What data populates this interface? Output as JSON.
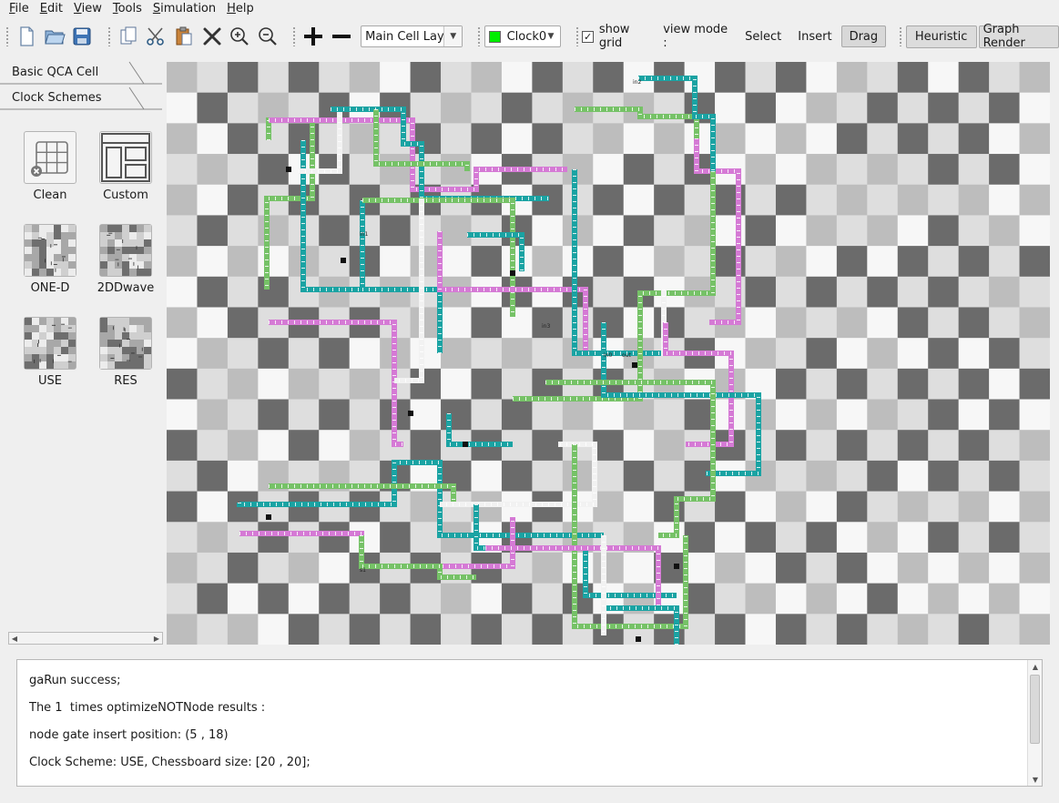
{
  "menubar": {
    "items": [
      {
        "key": "F",
        "rest": "ile"
      },
      {
        "key": "E",
        "rest": "dit"
      },
      {
        "key": "V",
        "rest": "iew"
      },
      {
        "key": "T",
        "rest": "ools"
      },
      {
        "key": "S",
        "rest": "imulation"
      },
      {
        "key": "H",
        "rest": "elp"
      }
    ]
  },
  "toolbar": {
    "layer_select": "Main Cell Layer",
    "clock_select": "Clock0",
    "clock_color": "#00ee00",
    "show_grid_label": "show grid",
    "show_grid_checked": "✓",
    "view_mode_label": "view mode :",
    "mode_select": "Select",
    "mode_insert": "Insert",
    "mode_drag": "Drag",
    "heuristic_label": "Heuristic",
    "graph_render_label": "Graph Render"
  },
  "left_panel": {
    "tab_basic": "Basic QCA Cell",
    "tab_clock": "Clock Schemes",
    "schemes": [
      "Clean",
      "Custom",
      "ONE-D",
      "2DDwave",
      "USE",
      "RES"
    ]
  },
  "canvas": {
    "grid_columns": 29,
    "grid_rows": 19,
    "colors": {
      "dark": "#6b6b6b",
      "mid": "#bdbdbd",
      "light": "#dedede",
      "white": "#f7f7f7",
      "wire_green": "#76c267",
      "wire_magenta": "#d57ad5",
      "wire_teal": "#1aa3a3",
      "wire_white": "#f2f2f2"
    },
    "labels": [
      "in2",
      "in1",
      "in3",
      "in0",
      "out",
      "s1"
    ]
  },
  "log": {
    "lines": [
      "gaRun success;",
      "The 1  times optimizeNOTNode results :",
      "node gate insert position: (5 , 18)",
      "Clock Scheme: USE, Chessboard size: [20 , 20];"
    ]
  }
}
